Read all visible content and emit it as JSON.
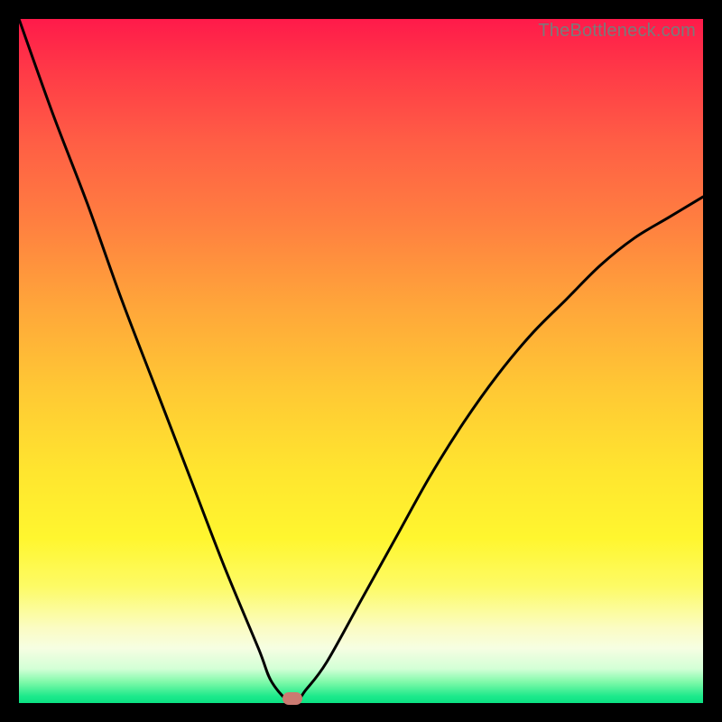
{
  "watermark": "TheBottleneck.com",
  "colors": {
    "frame": "#000000",
    "curve": "#000000",
    "marker": "#cb7a71"
  },
  "chart_data": {
    "type": "line",
    "title": "",
    "xlabel": "",
    "ylabel": "",
    "xlim": [
      0,
      100
    ],
    "ylim": [
      0,
      100
    ],
    "grid": false,
    "series": [
      {
        "name": "bottleneck-curve",
        "x": [
          0,
          5,
          10,
          15,
          20,
          25,
          30,
          35,
          37,
          40,
          42,
          45,
          50,
          55,
          60,
          65,
          70,
          75,
          80,
          85,
          90,
          95,
          100
        ],
        "values": [
          100,
          86,
          73,
          59,
          46,
          33,
          20,
          8,
          3,
          0,
          2,
          6,
          15,
          24,
          33,
          41,
          48,
          54,
          59,
          64,
          68,
          71,
          74
        ]
      }
    ],
    "annotations": [
      {
        "name": "optimal-marker",
        "x": 40,
        "y": 0.6
      }
    ],
    "background_gradient_top": "#ff1a4a",
    "background_gradient_bottom": "#0be283"
  }
}
